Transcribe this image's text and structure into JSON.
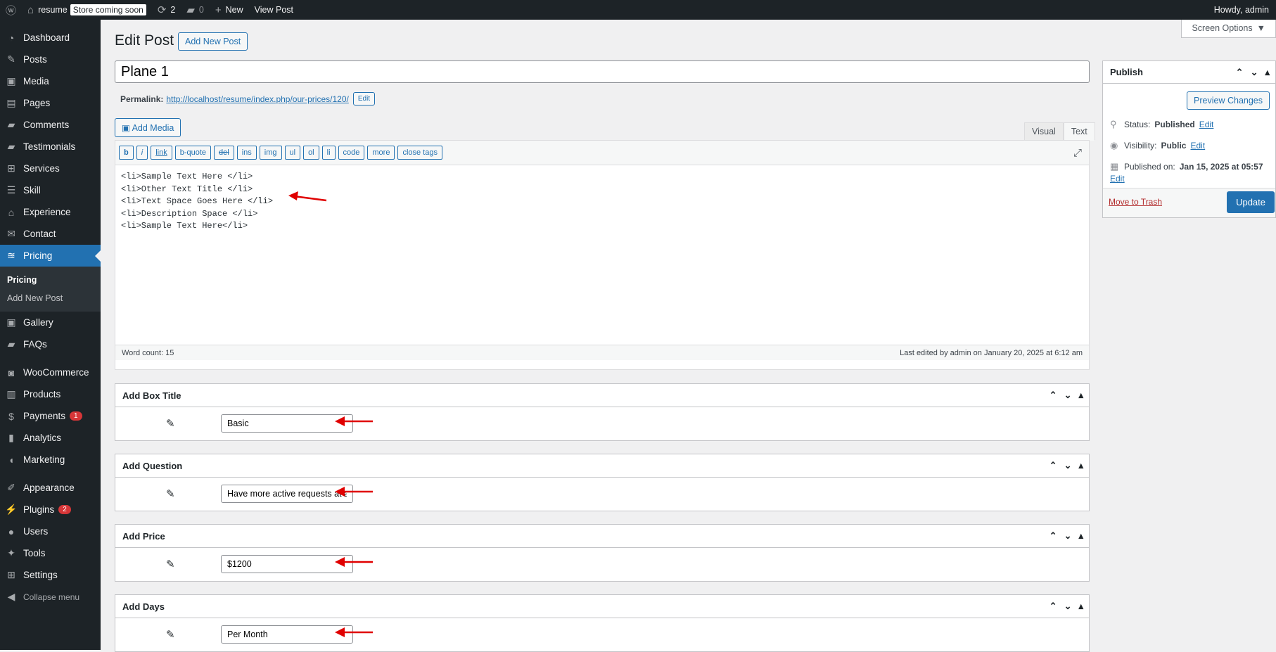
{
  "adminbar": {
    "site_name": "resume",
    "store_badge": "Store coming soon",
    "updates_count": "2",
    "comments_count": "0",
    "new_label": "New",
    "view_post_label": "View Post",
    "greeting": "Howdy, admin"
  },
  "screen_options": "Screen Options",
  "sidebar": {
    "items": [
      {
        "label": "Dashboard",
        "icon": "dashboard-icon"
      },
      {
        "label": "Posts",
        "icon": "pin-icon"
      },
      {
        "label": "Media",
        "icon": "media-icon"
      },
      {
        "label": "Pages",
        "icon": "pages-icon"
      },
      {
        "label": "Comments",
        "icon": "comment-icon"
      },
      {
        "label": "Testimonials",
        "icon": "comment-icon"
      },
      {
        "label": "Services",
        "icon": "grid-icon"
      },
      {
        "label": "Skill",
        "icon": "list-icon"
      },
      {
        "label": "Experience",
        "icon": "hat-icon"
      },
      {
        "label": "Contact",
        "icon": "mail-icon"
      },
      {
        "label": "Pricing",
        "icon": "money-icon"
      }
    ],
    "submenu": [
      "Pricing",
      "Add New Post"
    ],
    "items2": [
      {
        "label": "Gallery",
        "icon": "gallery-icon"
      },
      {
        "label": "FAQs",
        "icon": "comment-icon"
      }
    ],
    "items3": [
      {
        "label": "WooCommerce",
        "icon": "woo-icon"
      },
      {
        "label": "Products",
        "icon": "archive-icon"
      },
      {
        "label": "Payments",
        "icon": "dollar-icon",
        "badge": "1"
      },
      {
        "label": "Analytics",
        "icon": "chart-icon"
      },
      {
        "label": "Marketing",
        "icon": "megaphone-icon"
      }
    ],
    "items4": [
      {
        "label": "Appearance",
        "icon": "brush-icon"
      },
      {
        "label": "Plugins",
        "icon": "plug-icon",
        "badge": "2"
      },
      {
        "label": "Users",
        "icon": "user-icon"
      },
      {
        "label": "Tools",
        "icon": "wrench-icon"
      },
      {
        "label": "Settings",
        "icon": "settings-icon"
      },
      {
        "label": "Collapse menu",
        "icon": "collapse-icon"
      }
    ]
  },
  "page": {
    "title": "Edit Post",
    "add_new_label": "Add New Post",
    "post_title": "Plane 1",
    "permalink_label": "Permalink:",
    "permalink_url": "http://localhost/resume/index.php/our-prices/120/",
    "permalink_edit": "Edit",
    "add_media": "Add Media",
    "tab_visual": "Visual",
    "tab_text": "Text"
  },
  "editor": {
    "quicktags": [
      "b",
      "i",
      "link",
      "b-quote",
      "del",
      "ins",
      "img",
      "ul",
      "ol",
      "li",
      "code",
      "more",
      "close tags"
    ],
    "content": "<li>Sample Text Here </li>\n<li>Other Text Title </li>\n<li>Text Space Goes Here </li>\n<li>Description Space </li>\n<li>Sample Text Here</li>",
    "word_count": "Word count: 15",
    "last_edited": "Last edited by admin on January 20, 2025 at 6:12 am"
  },
  "metaboxes": [
    {
      "title": "Add Box Title",
      "value": "Basic"
    },
    {
      "title": "Add Question",
      "value": "Have more active requests at a time"
    },
    {
      "title": "Add Price",
      "value": "$1200"
    },
    {
      "title": "Add Days",
      "value": "Per Month"
    }
  ],
  "publish": {
    "title": "Publish",
    "preview": "Preview Changes",
    "status_label": "Status:",
    "status_value": "Published",
    "visibility_label": "Visibility:",
    "visibility_value": "Public",
    "published_label": "Published on:",
    "published_value": "Jan 15, 2025 at 05:57",
    "edit": "Edit",
    "trash": "Move to Trash",
    "update": "Update"
  },
  "colors": {
    "accent": "#2271b1",
    "annotation_arrow": "#e00000"
  }
}
